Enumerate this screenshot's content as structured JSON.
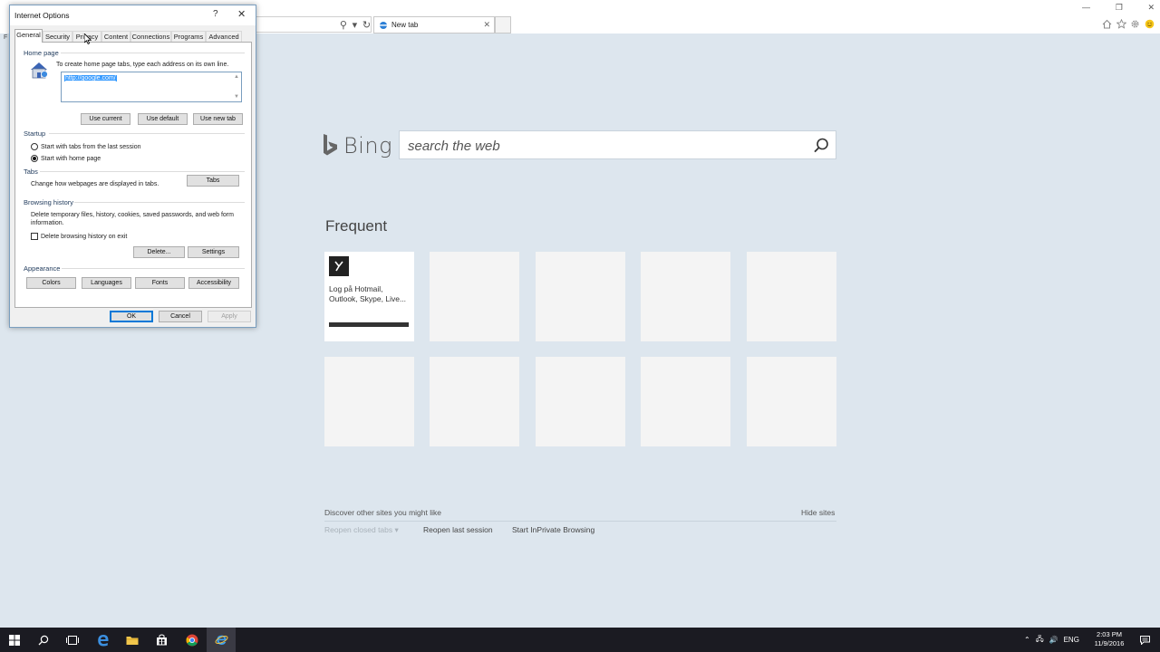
{
  "browser": {
    "tab_title": "New tab",
    "tab_close": "✕",
    "window_controls": [
      "—",
      "❐",
      "✕"
    ],
    "address_icons": [
      "⚲",
      "▾",
      "↻"
    ],
    "toolbar_icons": [
      "home-icon",
      "favorites-star-icon",
      "gear-icon",
      "smiley-icon"
    ],
    "menu_stub": "F"
  },
  "bing": {
    "logo_text": "Bing",
    "search_placeholder": "search the web",
    "frequent_title": "Frequent",
    "tiles": [
      {
        "label": "Log på Hotmail, Outlook, Skype, Live...",
        "has_content": true
      },
      {
        "label": "",
        "has_content": false
      },
      {
        "label": "",
        "has_content": false
      },
      {
        "label": "",
        "has_content": false
      },
      {
        "label": "",
        "has_content": false
      },
      {
        "label": "",
        "has_content": false
      },
      {
        "label": "",
        "has_content": false
      },
      {
        "label": "",
        "has_content": false
      },
      {
        "label": "",
        "has_content": false
      },
      {
        "label": "",
        "has_content": false
      }
    ],
    "discover_text": "Discover other sites you might like",
    "hide_sites": "Hide sites",
    "reopen_closed": "Reopen closed tabs ▾",
    "reopen_last": "Reopen last session",
    "inprivate": "Start InPrivate Browsing",
    "colors": {
      "background": "#dde6ee",
      "tile": "#f4f4f4"
    }
  },
  "dialog": {
    "title": "Internet Options",
    "help": "?",
    "close": "✕",
    "tabs": [
      "General",
      "Security",
      "Privacy",
      "Content",
      "Connections",
      "Programs",
      "Advanced"
    ],
    "active_tab": "General",
    "home_page": {
      "group": "Home page",
      "instruction": "To create home page tabs, type each address on its own line.",
      "value": "http://google.com/",
      "buttons": [
        "Use current",
        "Use default",
        "Use new tab"
      ]
    },
    "startup": {
      "group": "Startup",
      "option_last_session": "Start with tabs from the last session",
      "option_home_page": "Start with home page",
      "selected": "Start with home page"
    },
    "tabs_group": {
      "group": "Tabs",
      "description": "Change how webpages are displayed in tabs.",
      "button": "Tabs"
    },
    "browsing_history": {
      "group": "Browsing history",
      "description": "Delete temporary files, history, cookies, saved passwords, and web form information.",
      "checkbox_label": "Delete browsing history on exit",
      "checked": false,
      "delete_button": "Delete...",
      "settings_button": "Settings"
    },
    "appearance": {
      "group": "Appearance",
      "buttons": [
        "Colors",
        "Languages",
        "Fonts",
        "Accessibility"
      ]
    },
    "footer": {
      "ok": "OK",
      "cancel": "Cancel",
      "apply": "Apply"
    }
  },
  "taskbar": {
    "tray_lang": "ENG",
    "time": "2:03 PM",
    "date": "11/9/2016",
    "tray_icons": [
      "chevron-up-icon",
      "network-icon",
      "volume-icon"
    ]
  }
}
